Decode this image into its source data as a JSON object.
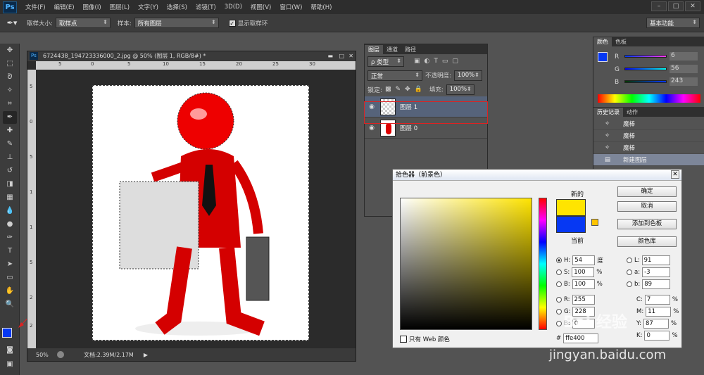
{
  "app": {
    "logo": "Ps"
  },
  "menu": [
    "文件(F)",
    "编辑(E)",
    "图像(I)",
    "图层(L)",
    "文字(Y)",
    "选择(S)",
    "滤镜(T)",
    "3D(D)",
    "视图(V)",
    "窗口(W)",
    "帮助(H)"
  ],
  "options": {
    "sample_size_label": "取样大小:",
    "sample_size_value": "取样点",
    "sample_label": "样本:",
    "sample_value": "所有图层",
    "show_ring_label": "显示取样环",
    "workspace": "基本功能"
  },
  "document": {
    "title": "6724438_194723336000_2.jpg @ 50% (图层 1, RGB/8#) *",
    "ps": "Ps",
    "zoom": "50%",
    "doc_info": "文档:2.39M/2.17M",
    "ruler_h": [
      "5",
      "0",
      "5",
      "10",
      "15",
      "20",
      "25",
      "30"
    ],
    "ruler_v": [
      "5",
      "0",
      "5",
      "1",
      "1",
      "5",
      "2",
      "2"
    ]
  },
  "layers": {
    "tabs": [
      "图层",
      "通道",
      "路径"
    ],
    "kind": "ρ 类型",
    "blend": "正常",
    "opacity_label": "不透明度:",
    "opacity": "100%",
    "lock_label": "锁定:",
    "fill_label": "填充:",
    "fill": "100%",
    "items": [
      {
        "name": "图层 1"
      },
      {
        "name": "图层 0"
      }
    ]
  },
  "color_panel": {
    "tabs": [
      "颜色",
      "色板"
    ],
    "r_label": "R",
    "g_label": "G",
    "b_label": "B",
    "r": "6",
    "g": "56",
    "b": "243",
    "r_frac": 0.02,
    "g_frac": 0.22,
    "b_frac": 0.95
  },
  "history": {
    "tabs": [
      "历史记录",
      "动作"
    ],
    "items": [
      "魔棒",
      "魔棒",
      "魔棒",
      "新建图层"
    ]
  },
  "picker": {
    "title": "拾色器（前景色）",
    "new_label": "新的",
    "current_label": "当前",
    "ok": "确定",
    "cancel": "取消",
    "add_swatch": "添加到色板",
    "libraries": "颜色库",
    "h_label": "H:",
    "h": "54",
    "h_unit": "度",
    "s_label": "S:",
    "s": "100",
    "s_unit": "%",
    "b_label": "B:",
    "b": "100",
    "b_unit": "%",
    "r_label": "R:",
    "r": "255",
    "g_label": "G:",
    "g": "228",
    "bb_label": "B:",
    "bb": "0",
    "l_label": "L:",
    "l": "91",
    "a_label": "a:",
    "a": "-3",
    "lb_label": "b:",
    "lb": "89",
    "c_label": "C:",
    "c": "7",
    "c_unit": "%",
    "m_label": "M:",
    "m": "11",
    "m_unit": "%",
    "y_label": "Y:",
    "y": "87",
    "y_unit": "%",
    "k_label": "K:",
    "k": "0",
    "k_unit": "%",
    "hex_label": "#",
    "hex": "ffe400",
    "web_only": "只有 Web 颜色",
    "new_color": "#ffe400",
    "current_color": "#0638f3"
  },
  "watermark": {
    "brand": "Bai 经验",
    "url": "jingyan.baidu.com"
  },
  "colors": {
    "fg": "#0638f3",
    "bg": "#ffffff"
  }
}
